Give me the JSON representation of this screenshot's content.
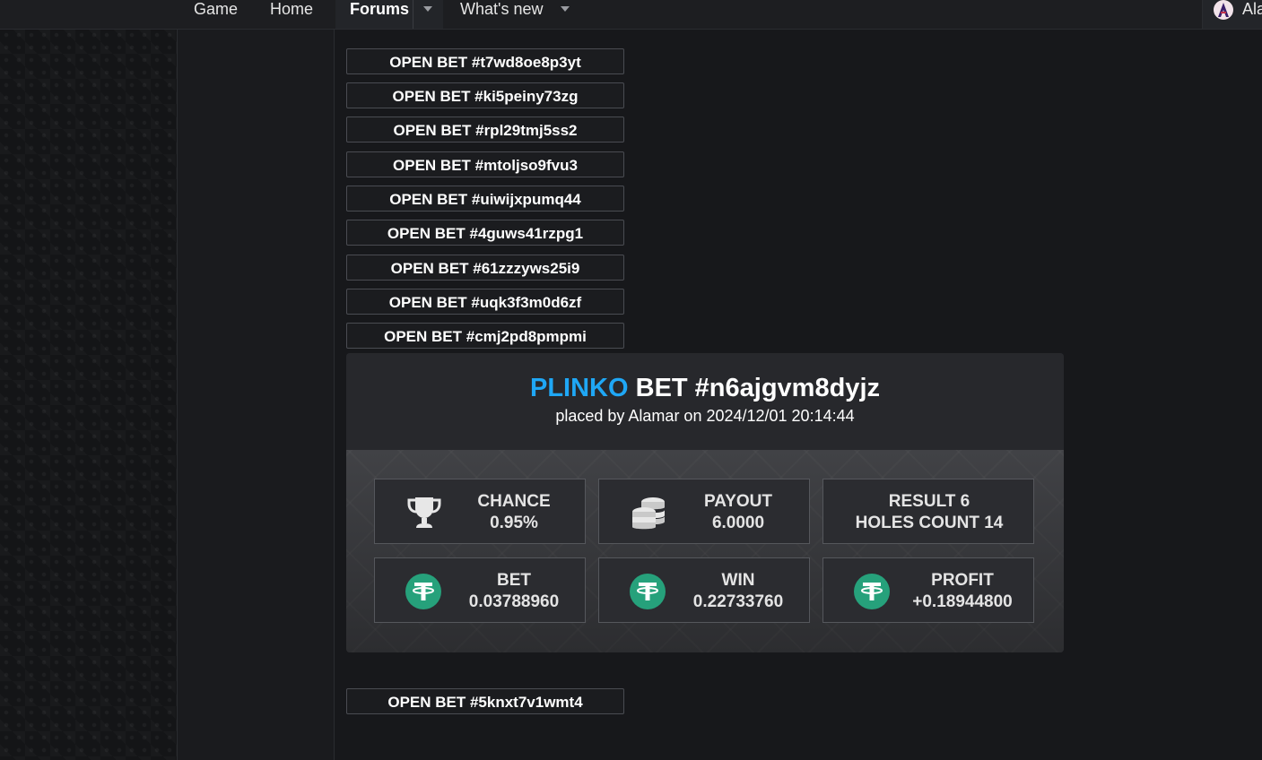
{
  "nav": {
    "items": [
      "Game",
      "Home",
      "Forums",
      "What's new"
    ],
    "user_name": "Ala",
    "active_item": "Forums"
  },
  "open_bets_top": [
    "OPEN BET #t7wd8oe8p3yt",
    "OPEN BET #ki5peiny73zg",
    "OPEN BET #rpl29tmj5ss2",
    "OPEN BET #mtoljso9fvu3",
    "OPEN BET #uiwijxpumq44",
    "OPEN BET #4guws41rzpg1",
    "OPEN BET #61zzzyws25i9",
    "OPEN BET #uqk3f3m0d6zf",
    "OPEN BET #cmj2pd8pmpmi"
  ],
  "bet_card": {
    "game": "PLINKO",
    "title_rest": "BET #n6ajgvm8dyjz",
    "subtitle": "placed by Alamar on 2024/12/01 20:14:44",
    "accent_color": "#1fa7f5",
    "stats": {
      "chance_label": "CHANCE",
      "chance_value": "0.95%",
      "payout_label": "PAYOUT",
      "payout_value": "6.0000",
      "result_label": "RESULT 6",
      "holes_label": "HOLES COUNT 14",
      "bet_label": "BET",
      "bet_value": "0.03788960",
      "win_label": "WIN",
      "win_value": "0.22733760",
      "profit_label": "PROFIT",
      "profit_value": "+0.18944800"
    },
    "icons": [
      "trophy-icon",
      "coins-stack-icon",
      "tether-icon"
    ],
    "tether_color": "#26a17b"
  },
  "open_bet_bottom": "OPEN BET #5knxt7v1wmt4"
}
